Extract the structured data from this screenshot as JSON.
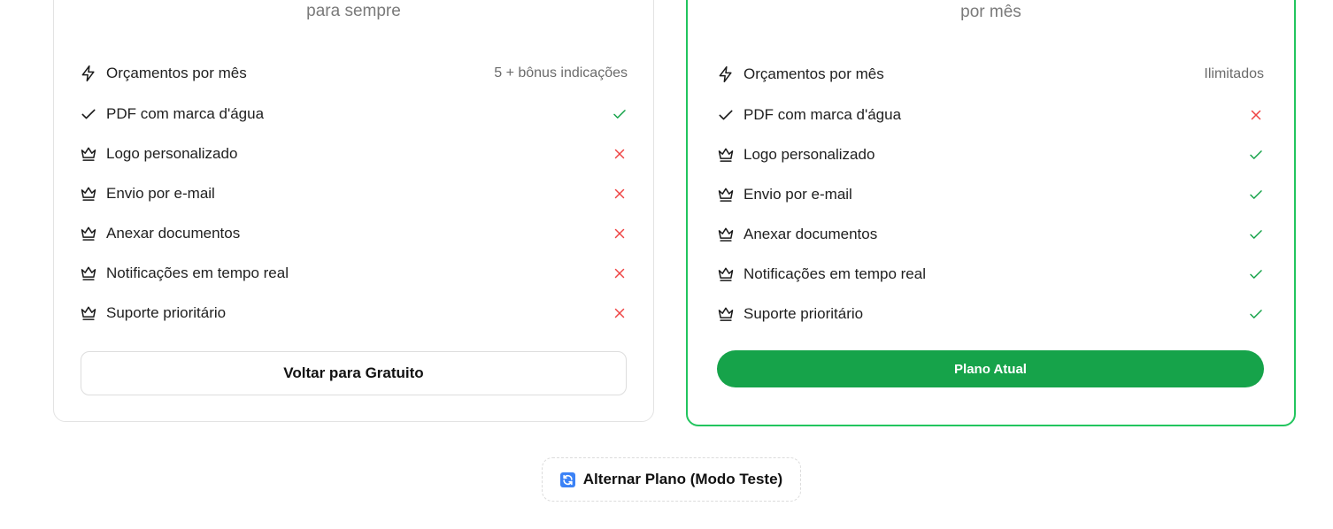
{
  "colors": {
    "accent": "#16a34a",
    "accent_border": "#22c55e",
    "check": "#16a34a",
    "cross": "#ef4444"
  },
  "plans": [
    {
      "period": "para sempre",
      "features": [
        {
          "icon": "zap-icon",
          "label": "Orçamentos por mês",
          "value": "5 + bônus indicações"
        },
        {
          "icon": "check-icon",
          "label": "PDF com marca d'água",
          "status": "check"
        },
        {
          "icon": "crown-icon",
          "label": "Logo personalizado",
          "status": "cross"
        },
        {
          "icon": "crown-icon",
          "label": "Envio por e-mail",
          "status": "cross"
        },
        {
          "icon": "crown-icon",
          "label": "Anexar documentos",
          "status": "cross"
        },
        {
          "icon": "crown-icon",
          "label": "Notificações em tempo real",
          "status": "cross"
        },
        {
          "icon": "crown-icon",
          "label": "Suporte prioritário",
          "status": "cross"
        }
      ],
      "button_label": "Voltar para Gratuito"
    },
    {
      "period": "por mês",
      "features": [
        {
          "icon": "zap-icon",
          "label": "Orçamentos por mês",
          "value": "Ilimitados"
        },
        {
          "icon": "check-icon",
          "label": "PDF com marca d'água",
          "status": "cross"
        },
        {
          "icon": "crown-icon",
          "label": "Logo personalizado",
          "status": "check"
        },
        {
          "icon": "crown-icon",
          "label": "Envio por e-mail",
          "status": "check"
        },
        {
          "icon": "crown-icon",
          "label": "Anexar documentos",
          "status": "check"
        },
        {
          "icon": "crown-icon",
          "label": "Notificações em tempo real",
          "status": "check"
        },
        {
          "icon": "crown-icon",
          "label": "Suporte prioritário",
          "status": "check"
        }
      ],
      "button_label": "Plano Atual"
    }
  ],
  "toggle": {
    "icon": "refresh-icon",
    "label": "Alternar Plano (Modo Teste)"
  }
}
